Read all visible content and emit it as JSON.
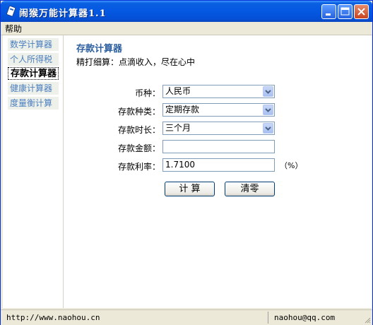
{
  "window": {
    "title": "闹猴万能计算器1.1"
  },
  "menu": {
    "help": "帮助"
  },
  "sidebar": {
    "items": [
      {
        "label": "数学计算器"
      },
      {
        "label": "个人所得税"
      },
      {
        "label": "存款计算器"
      },
      {
        "label": "健康计算器"
      },
      {
        "label": "度量衡计算"
      }
    ],
    "active_index": 2
  },
  "main": {
    "title": "存款计算器",
    "subtitle": "精打细算：点滴收入，尽在心中",
    "currency": {
      "label": "币种：",
      "value": "人民币"
    },
    "deposit_type": {
      "label": "存款种类：",
      "value": "定期存款"
    },
    "duration": {
      "label": "存款时长：",
      "value": "三个月"
    },
    "amount": {
      "label": "存款金额：",
      "value": ""
    },
    "rate": {
      "label": "存款利率：",
      "value": "1.7100",
      "unit": "（%）"
    },
    "calc_button": "计 算",
    "clear_button": "清零"
  },
  "statusbar": {
    "url": "http://www.naohou.cn",
    "email": "naohou@qq.com"
  },
  "colors": {
    "titlebar": "#0558e2",
    "nav_text": "#4b7fbf",
    "title_text": "#2c5f9e"
  }
}
